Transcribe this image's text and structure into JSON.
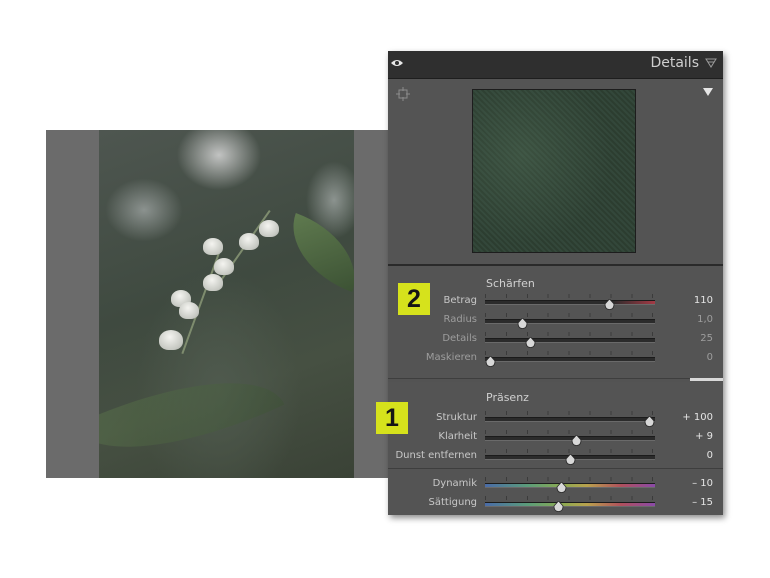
{
  "panel": {
    "title": "Details",
    "sharpening": {
      "title": "Schärfen",
      "badge": "2",
      "rows": [
        {
          "label": "Betrag",
          "value": "110",
          "fraction": 0.73,
          "track": "red",
          "dim": false
        },
        {
          "label": "Radius",
          "value": "1,0",
          "fraction": 0.22,
          "track": "plain",
          "dim": true
        },
        {
          "label": "Details",
          "value": "25",
          "fraction": 0.27,
          "track": "plain",
          "dim": true
        },
        {
          "label": "Maskieren",
          "value": "0",
          "fraction": 0.03,
          "track": "plain",
          "dim": true
        }
      ]
    },
    "presence": {
      "title": "Präsenz",
      "badge": "1",
      "rows": [
        {
          "label": "Struktur",
          "value": "+ 100",
          "fraction": 0.97,
          "track": "plain",
          "dim": false
        },
        {
          "label": "Klarheit",
          "value": "+ 9",
          "fraction": 0.54,
          "track": "plain",
          "dim": false
        },
        {
          "label": "Dunst entfernen",
          "value": "0",
          "fraction": 0.5,
          "track": "plain",
          "dim": false
        },
        {
          "label": "Dynamik",
          "value": "– 10",
          "fraction": 0.45,
          "track": "spectrum",
          "dim": false
        },
        {
          "label": "Sättigung",
          "value": "– 15",
          "fraction": 0.43,
          "track": "spectrum",
          "dim": false
        }
      ]
    }
  },
  "colors": {
    "badge": "#d6e21c",
    "panel_bg": "#535353",
    "header_bg": "#2f2f2f"
  }
}
